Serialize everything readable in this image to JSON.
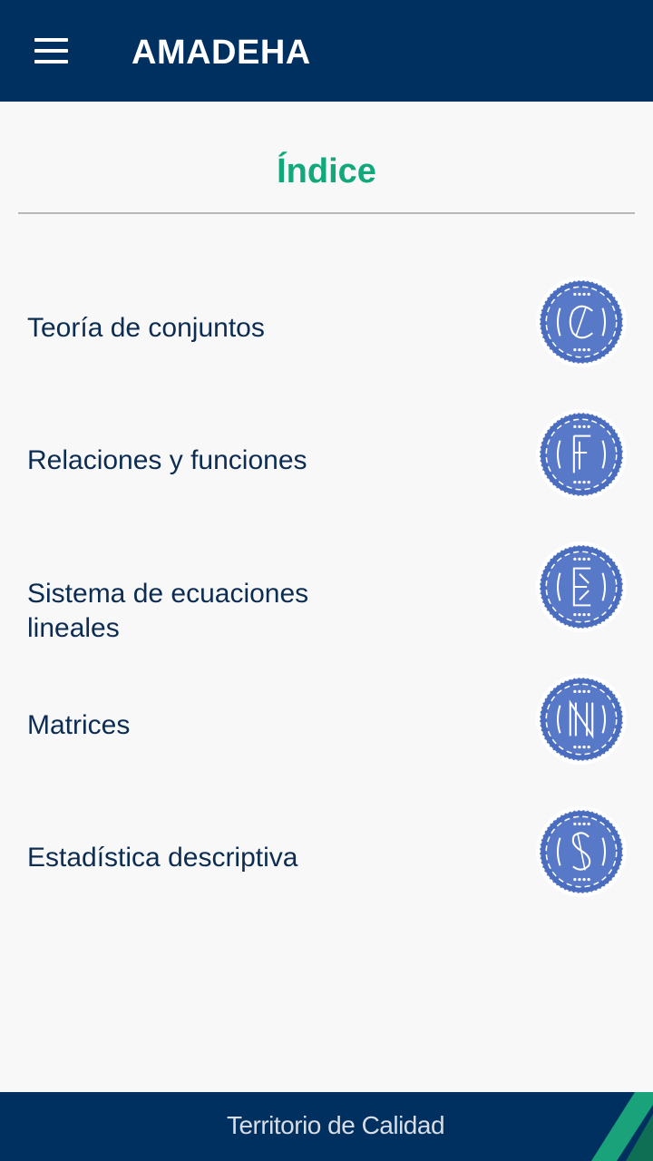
{
  "header": {
    "title": "AMADEHA",
    "menu_icon": "hamburger-menu-icon",
    "background": "#00305f"
  },
  "main": {
    "heading": "Índice",
    "heading_color": "#11a87c",
    "items": [
      {
        "label": "Teoría de conjuntos",
        "icon": "letter-c-badge-icon",
        "letter": "C"
      },
      {
        "label": "Relaciones y funciones",
        "icon": "letter-f-badge-icon",
        "letter": "F"
      },
      {
        "label": "Sistema de ecuaciones lineales",
        "icon": "letter-e-badge-icon",
        "letter": "E"
      },
      {
        "label": "Matrices",
        "icon": "letter-m-badge-icon",
        "letter": "M"
      },
      {
        "label": "Estadística descriptiva",
        "icon": "letter-s-badge-icon",
        "letter": "S"
      }
    ],
    "badge_color": "#4a6dbf"
  },
  "footer": {
    "text": "Territorio de Calidad",
    "accent_color": "#1aa37a"
  }
}
